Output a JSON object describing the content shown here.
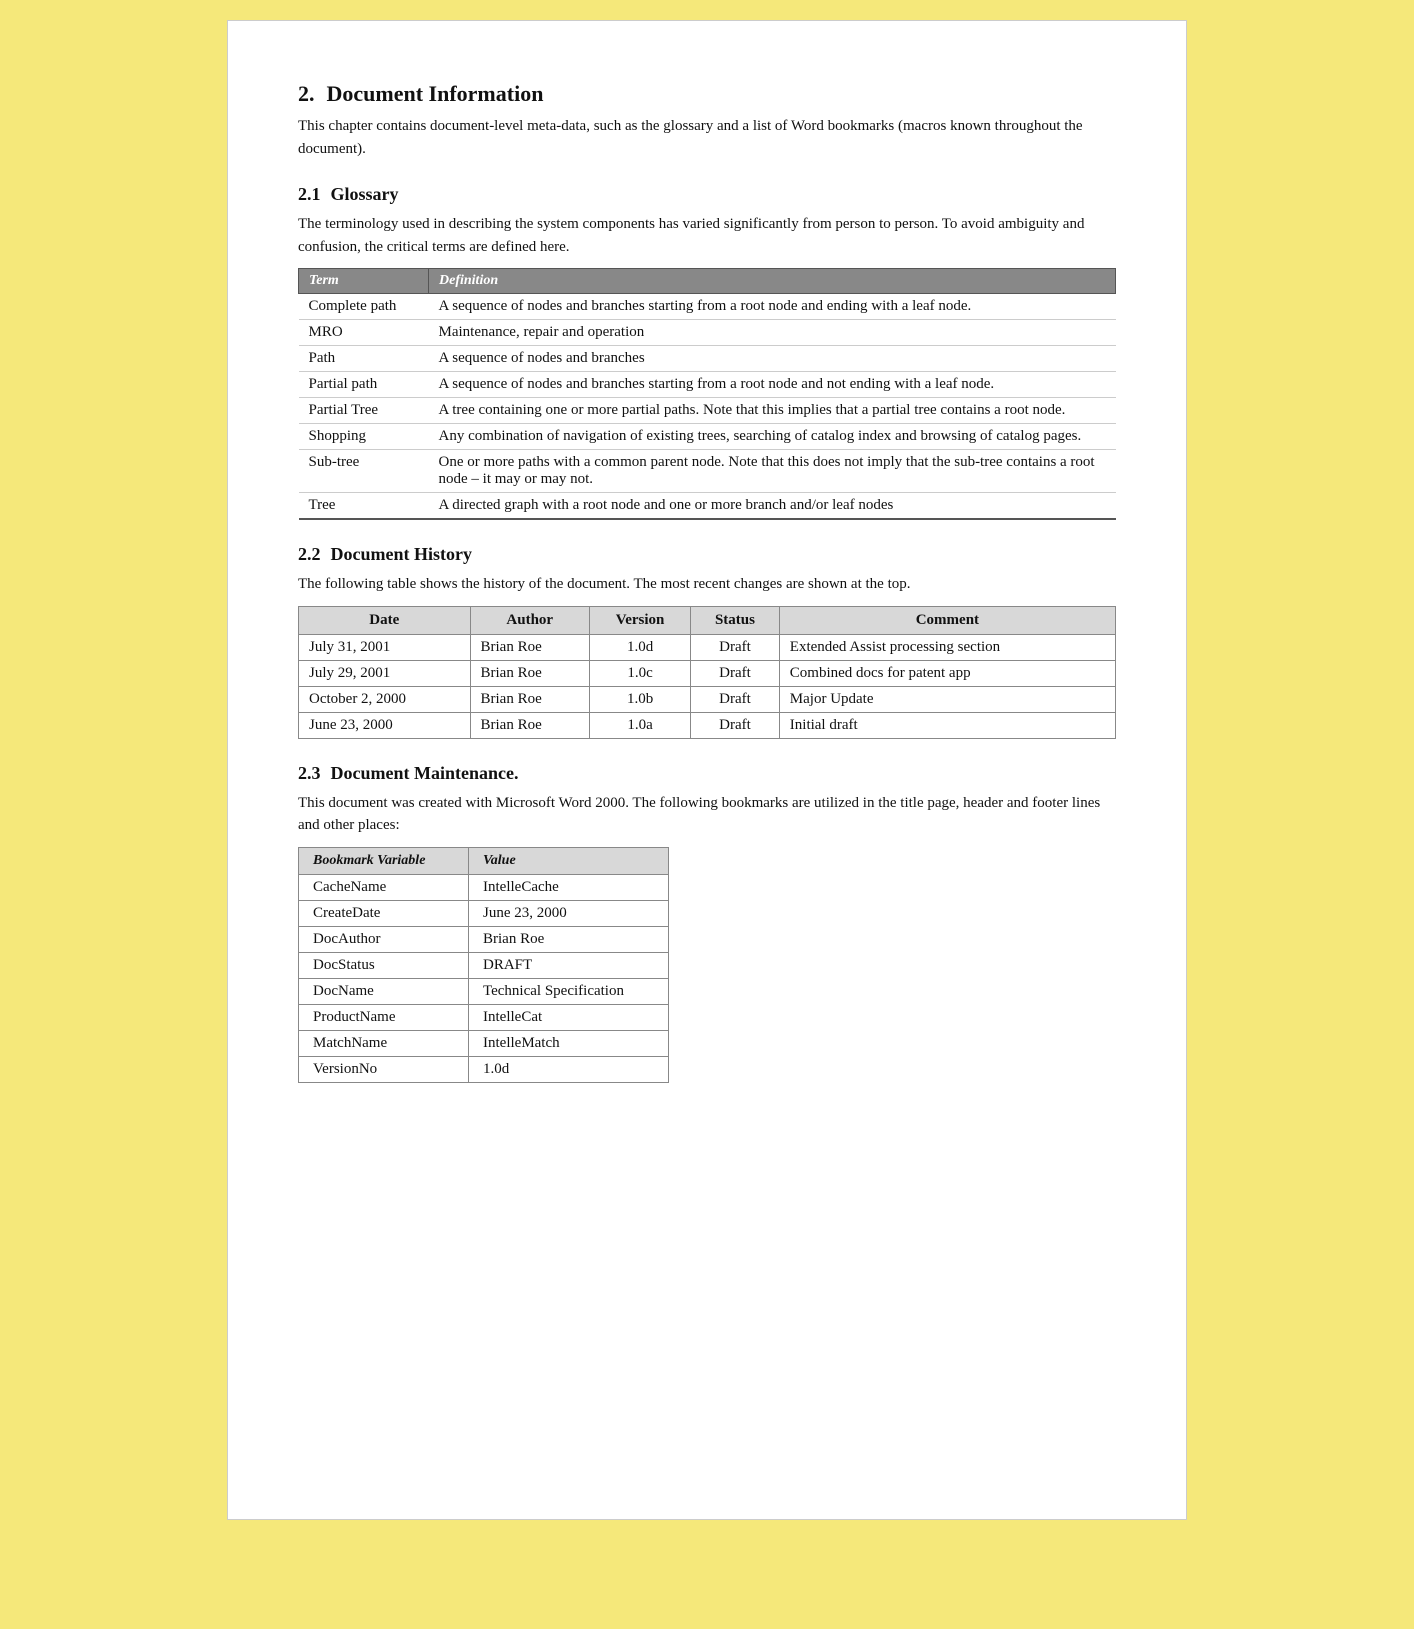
{
  "section": {
    "num": "2.",
    "title": "Document Information",
    "intro": "This chapter contains document-level meta-data, such as the glossary and a list of Word bookmarks (macros known throughout the document).",
    "subsections": [
      {
        "num": "2.1",
        "title": "Glossary",
        "intro": "The terminology used in describing the system components has varied significantly from person to person.  To avoid ambiguity and confusion, the critical terms are defined here.",
        "table": {
          "headers": [
            "Term",
            "Definition"
          ],
          "rows": [
            [
              "Complete path",
              "A sequence of nodes and branches starting from a root node and ending with a leaf node."
            ],
            [
              "MRO",
              "Maintenance, repair and operation"
            ],
            [
              "Path",
              "A sequence of nodes and branches"
            ],
            [
              "Partial path",
              "A sequence of nodes and branches starting from a root node and not ending with a leaf node."
            ],
            [
              "Partial Tree",
              "A tree containing one or more partial paths.  Note that this implies that a partial tree contains a root node."
            ],
            [
              "Shopping",
              "Any combination of navigation of existing trees, searching of catalog index and browsing of catalog pages."
            ],
            [
              "Sub-tree",
              "One or more paths with a common parent node.  Note that this does not imply that the sub-tree contains a root node – it may or may not."
            ],
            [
              "Tree",
              "A directed graph with a root node and one or more branch and/or leaf nodes"
            ]
          ]
        }
      },
      {
        "num": "2.2",
        "title": "Document History",
        "intro": "The following table shows the history of the document.  The most recent changes are shown at the top.",
        "table": {
          "headers": [
            "Date",
            "Author",
            "Version",
            "Status",
            "Comment"
          ],
          "rows": [
            [
              "July 31, 2001",
              "Brian Roe",
              "1.0d",
              "Draft",
              "Extended Assist processing section"
            ],
            [
              "July 29, 2001",
              "Brian Roe",
              "1.0c",
              "Draft",
              "Combined docs for patent app"
            ],
            [
              "October 2, 2000",
              "Brian Roe",
              "1.0b",
              "Draft",
              "Major Update"
            ],
            [
              "June 23, 2000",
              "Brian Roe",
              "1.0a",
              "Draft",
              "Initial draft"
            ]
          ]
        }
      },
      {
        "num": "2.3",
        "title": "Document Maintenance.",
        "intro": "This document was created with Microsoft Word 2000. The following bookmarks are utilized in the title page, header and footer lines and other places:",
        "table": {
          "headers": [
            "Bookmark Variable",
            "Value"
          ],
          "rows": [
            [
              "CacheName",
              "IntelleCache"
            ],
            [
              "CreateDate",
              "June 23, 2000"
            ],
            [
              "DocAuthor",
              "Brian Roe"
            ],
            [
              "DocStatus",
              "DRAFT"
            ],
            [
              "DocName",
              "Technical Specification"
            ],
            [
              "ProductName",
              "IntelleCat"
            ],
            [
              "MatchName",
              "IntelleMatch"
            ],
            [
              "VersionNo",
              "1.0d"
            ]
          ]
        }
      }
    ]
  }
}
